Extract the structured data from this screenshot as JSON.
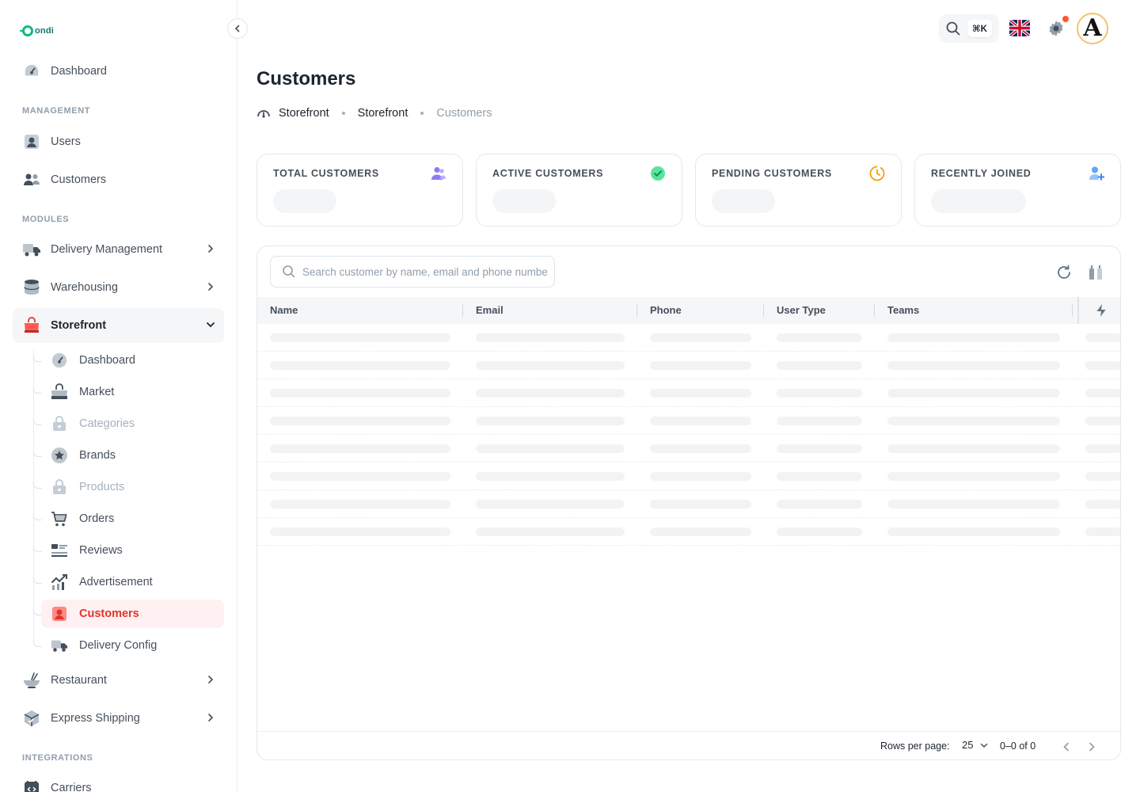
{
  "app": {
    "logo_text": "ondi"
  },
  "sidebar": {
    "dashboard_label": "Dashboard",
    "sections": {
      "management": "MANAGEMENT",
      "modules": "MODULES",
      "integrations": "INTEGRATIONS"
    },
    "management_items": [
      {
        "label": "Users",
        "icon": "user-badge-icon"
      },
      {
        "label": "Customers",
        "icon": "users-group-icon"
      }
    ],
    "module_items": [
      {
        "label": "Delivery Management",
        "icon": "truck-icon"
      },
      {
        "label": "Warehousing",
        "icon": "warehouse-icon"
      },
      {
        "label": "Storefront",
        "icon": "shopping-bag-icon",
        "accent": "#e5322d"
      }
    ],
    "storefront_sub": [
      {
        "label": "Dashboard",
        "icon": "gauge-icon"
      },
      {
        "label": "Market",
        "icon": "bag-icon"
      },
      {
        "label": "Categories",
        "icon": "lock-icon",
        "disabled": true
      },
      {
        "label": "Brands",
        "icon": "star-badge-icon"
      },
      {
        "label": "Products",
        "icon": "lock-icon",
        "disabled": true
      },
      {
        "label": "Orders",
        "icon": "cart-icon"
      },
      {
        "label": "Reviews",
        "icon": "review-list-icon"
      },
      {
        "label": "Advertisement",
        "icon": "trend-chart-icon"
      },
      {
        "label": "Customers",
        "icon": "user-badge-icon",
        "active": true
      },
      {
        "label": "Delivery Config",
        "icon": "truck-icon"
      }
    ],
    "more_items": [
      {
        "label": "Restaurant",
        "icon": "food-bowl-icon"
      },
      {
        "label": "Express Shipping",
        "icon": "package-icon"
      }
    ],
    "integration_items": [
      {
        "label": "Carriers",
        "icon": "code-box-icon"
      }
    ]
  },
  "topbar": {
    "shortcut": "⌘K",
    "avatar_letter": "A",
    "notification_color": "#ff5630"
  },
  "page": {
    "title": "Customers",
    "breadcrumb": [
      "Storefront",
      "Storefront",
      "Customers"
    ]
  },
  "stats": [
    {
      "label": "TOTAL CUSTOMERS",
      "icon": "users-group-icon",
      "color": "#8b7cf6"
    },
    {
      "label": "ACTIVE CUSTOMERS",
      "icon": "check-circle-icon",
      "color": "#22c55e"
    },
    {
      "label": "PENDING CUSTOMERS",
      "icon": "clock-icon",
      "color": "#f59e0b"
    },
    {
      "label": "RECENTLY JOINED",
      "icon": "user-add-icon",
      "color": "#60a5fa"
    }
  ],
  "table": {
    "search_placeholder": "Search customer by name, email and phone number",
    "columns": [
      "Name",
      "Email",
      "Phone",
      "User Type",
      "Teams"
    ],
    "loading_rows": 8,
    "footer": {
      "rows_per_page_label": "Rows per page:",
      "rows_per_page": "25",
      "range": "0–0 of 0"
    }
  }
}
